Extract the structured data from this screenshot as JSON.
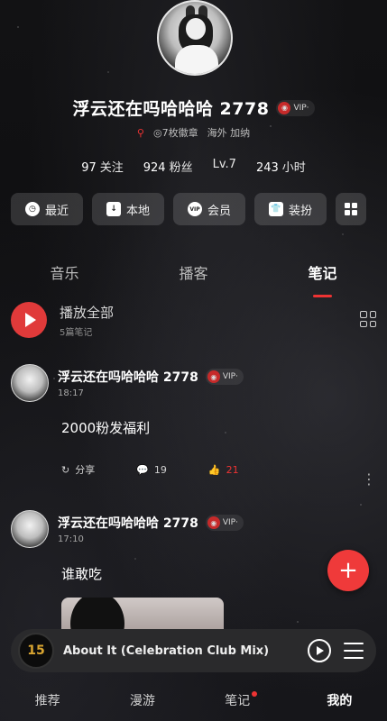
{
  "profile": {
    "name": "浮云还在吗哈哈哈 2778",
    "vip_label": "VIP·",
    "badges": "7枚徽章",
    "location": "海外 加纳",
    "stats": {
      "follow": "97",
      "follow_label": "关注",
      "fans": "924",
      "fans_label": "粉丝",
      "level": "Lv.7",
      "hours": "243",
      "hours_label": "小时"
    }
  },
  "quick_buttons": [
    {
      "label": "最近",
      "icon": "clock-icon"
    },
    {
      "label": "本地",
      "icon": "download-icon"
    },
    {
      "label": "会员",
      "icon": "vip-icon"
    },
    {
      "label": "装扮",
      "icon": "shirt-icon"
    }
  ],
  "tabs": [
    "音乐",
    "播客",
    "笔记"
  ],
  "play_all": {
    "title": "播放全部",
    "subtitle": "5篇笔记"
  },
  "notes": [
    {
      "author": "浮云还在吗哈哈哈 2778",
      "vip": "VIP·",
      "time": "18:17",
      "text": "2000粉发福利",
      "share": "分享",
      "comments": "19",
      "likes": "21"
    },
    {
      "author": "浮云还在吗哈哈哈 2778",
      "vip": "VIP·",
      "time": "17:10",
      "text": "谁敢吃"
    }
  ],
  "player": {
    "song": "About It (Celebration Club Mix)",
    "cover_text": "15"
  },
  "bottom_nav": [
    "推荐",
    "漫游",
    "笔记",
    "我的"
  ],
  "colors": {
    "accent": "#e03a3a"
  }
}
